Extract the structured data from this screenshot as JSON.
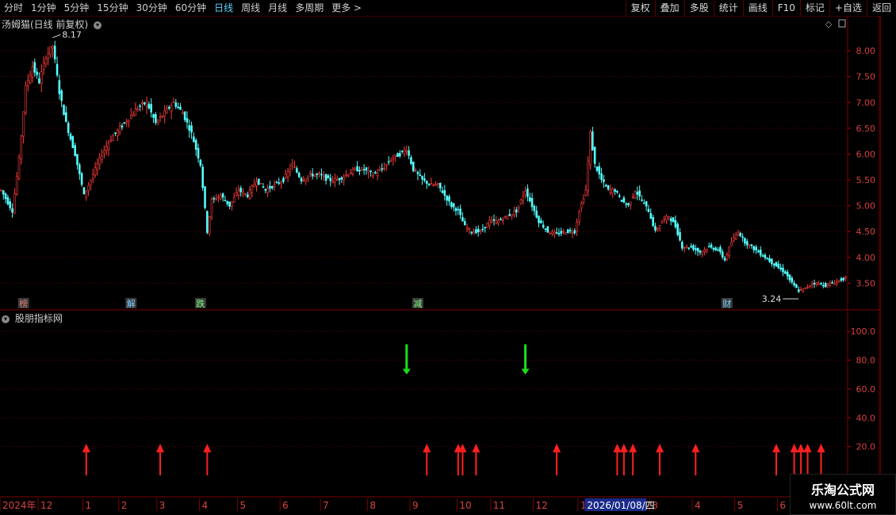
{
  "toolbar": {
    "left_items": [
      "分时",
      "1分钟",
      "5分钟",
      "15分钟",
      "30分钟",
      "60分钟",
      "日线",
      "周线",
      "月线",
      "多周期",
      "更多 >"
    ],
    "active_index": 6,
    "right_items": [
      "复权",
      "叠加",
      "多股",
      "统计",
      "画线",
      "F10",
      "标记",
      "+自选",
      "返回"
    ]
  },
  "main_pane": {
    "title": "汤姆猫(日线 前复权)",
    "high_label": "8.17",
    "low_label": "3.24",
    "event_tags": [
      {
        "label": "榜",
        "bar": 10,
        "color": "#e07a7a"
      },
      {
        "label": "解",
        "bar": 58,
        "color": "#7ad0ff"
      },
      {
        "label": "跌",
        "bar": 89,
        "color": "#7fff7f"
      },
      {
        "label": "减",
        "bar": 186,
        "color": "#7fff7f"
      },
      {
        "label": "财",
        "bar": 324,
        "color": "#7ad0ff"
      }
    ]
  },
  "indicator_pane": {
    "title": "股朋指标网",
    "green_arrow_bars": [
      181,
      234
    ],
    "red_arrow_bars": [
      38,
      71,
      92,
      190,
      204,
      206,
      212,
      248,
      275,
      278,
      282,
      294,
      310,
      346,
      354,
      357,
      360,
      366
    ]
  },
  "time_axis": {
    "labels": [
      {
        "text": "2024年",
        "bar": 0
      },
      {
        "text": "12",
        "bar": 17
      },
      {
        "text": "1",
        "bar": 37
      },
      {
        "text": "2",
        "bar": 53
      },
      {
        "text": "3",
        "bar": 70
      },
      {
        "text": "4",
        "bar": 89
      },
      {
        "text": "5",
        "bar": 106
      },
      {
        "text": "6",
        "bar": 125
      },
      {
        "text": "7",
        "bar": 143
      },
      {
        "text": "8",
        "bar": 164
      },
      {
        "text": "9",
        "bar": 183
      },
      {
        "text": "10",
        "bar": 204
      },
      {
        "text": "11",
        "bar": 219
      },
      {
        "text": "12",
        "bar": 238
      },
      {
        "text": "1",
        "bar": 258
      },
      {
        "text": "3",
        "bar": 290
      },
      {
        "text": "4",
        "bar": 309
      },
      {
        "text": "5",
        "bar": 328
      },
      {
        "text": "6",
        "bar": 347
      }
    ],
    "cursor_date": "2026/01/08/四",
    "cursor_bar": 261
  },
  "watermark": {
    "line1": "乐淘公式网",
    "line2": "www.60lt.com"
  },
  "chart_data": [
    {
      "type": "line",
      "title": "汤姆猫(日线 前复权)",
      "xlabel": "",
      "ylabel": "",
      "ylim": [
        3.0,
        8.4
      ],
      "y_ticks": [
        3.5,
        4.0,
        4.5,
        5.0,
        5.5,
        6.0,
        6.5,
        7.0,
        7.5,
        8.0
      ],
      "grid": true,
      "series": [
        {
          "keypoints": [
            [
              0,
              5.3
            ],
            [
              5,
              4.9
            ],
            [
              8,
              5.9
            ],
            [
              11,
              7.3
            ],
            [
              14,
              7.7
            ],
            [
              17,
              7.4
            ],
            [
              20,
              7.9
            ],
            [
              23,
              8.1
            ],
            [
              26,
              7.2
            ],
            [
              29,
              6.6
            ],
            [
              33,
              6.0
            ],
            [
              37,
              5.2
            ],
            [
              41,
              5.6
            ],
            [
              45,
              6.0
            ],
            [
              49,
              6.3
            ],
            [
              53,
              6.5
            ],
            [
              57,
              6.7
            ],
            [
              61,
              6.9
            ],
            [
              65,
              7.0
            ],
            [
              69,
              6.6
            ],
            [
              73,
              6.8
            ],
            [
              77,
              7.0
            ],
            [
              81,
              6.8
            ],
            [
              85,
              6.4
            ],
            [
              89,
              5.8
            ],
            [
              92,
              4.5
            ],
            [
              94,
              5.1
            ],
            [
              98,
              5.2
            ],
            [
              102,
              5.0
            ],
            [
              106,
              5.3
            ],
            [
              110,
              5.2
            ],
            [
              114,
              5.5
            ],
            [
              118,
              5.3
            ],
            [
              122,
              5.4
            ],
            [
              126,
              5.5
            ],
            [
              130,
              5.8
            ],
            [
              134,
              5.5
            ],
            [
              138,
              5.6
            ],
            [
              142,
              5.6
            ],
            [
              146,
              5.5
            ],
            [
              150,
              5.5
            ],
            [
              154,
              5.6
            ],
            [
              158,
              5.7
            ],
            [
              162,
              5.7
            ],
            [
              166,
              5.6
            ],
            [
              170,
              5.7
            ],
            [
              174,
              5.9
            ],
            [
              178,
              6.0
            ],
            [
              181,
              6.1
            ],
            [
              184,
              5.7
            ],
            [
              188,
              5.5
            ],
            [
              192,
              5.4
            ],
            [
              195,
              5.4
            ],
            [
              198,
              5.2
            ],
            [
              201,
              5.0
            ],
            [
              204,
              4.9
            ],
            [
              207,
              4.6
            ],
            [
              210,
              4.5
            ],
            [
              214,
              4.5
            ],
            [
              218,
              4.7
            ],
            [
              222,
              4.7
            ],
            [
              226,
              4.8
            ],
            [
              230,
              4.9
            ],
            [
              234,
              5.3
            ],
            [
              237,
              5.0
            ],
            [
              240,
              4.7
            ],
            [
              244,
              4.5
            ],
            [
              248,
              4.45
            ],
            [
              252,
              4.5
            ],
            [
              256,
              4.5
            ],
            [
              258,
              4.9
            ],
            [
              261,
              5.3
            ],
            [
              263,
              6.4
            ],
            [
              265,
              5.8
            ],
            [
              268,
              5.5
            ],
            [
              271,
              5.3
            ],
            [
              274,
              5.3
            ],
            [
              277,
              5.1
            ],
            [
              280,
              5.0
            ],
            [
              283,
              5.3
            ],
            [
              286,
              5.1
            ],
            [
              289,
              4.9
            ],
            [
              292,
              4.5
            ],
            [
              295,
              4.7
            ],
            [
              298,
              4.8
            ],
            [
              301,
              4.6
            ],
            [
              304,
              4.2
            ],
            [
              308,
              4.2
            ],
            [
              312,
              4.1
            ],
            [
              316,
              4.2
            ],
            [
              320,
              4.15
            ],
            [
              323,
              3.95
            ],
            [
              326,
              4.3
            ],
            [
              329,
              4.5
            ],
            [
              332,
              4.3
            ],
            [
              335,
              4.2
            ],
            [
              338,
              4.1
            ],
            [
              341,
              4.0
            ],
            [
              344,
              3.9
            ],
            [
              347,
              3.8
            ],
            [
              350,
              3.7
            ],
            [
              353,
              3.5
            ],
            [
              356,
              3.35
            ],
            [
              359,
              3.4
            ],
            [
              362,
              3.5
            ],
            [
              365,
              3.5
            ],
            [
              368,
              3.45
            ],
            [
              371,
              3.5
            ],
            [
              374,
              3.55
            ],
            [
              377,
              3.6
            ]
          ]
        }
      ]
    },
    {
      "type": "bar",
      "title": "股朋指标网",
      "xlabel": "",
      "ylabel": "",
      "ylim": [
        0,
        110
      ],
      "y_ticks": [
        20.0,
        40.0,
        60.0,
        80.0,
        100.0
      ],
      "grid": true
    }
  ]
}
